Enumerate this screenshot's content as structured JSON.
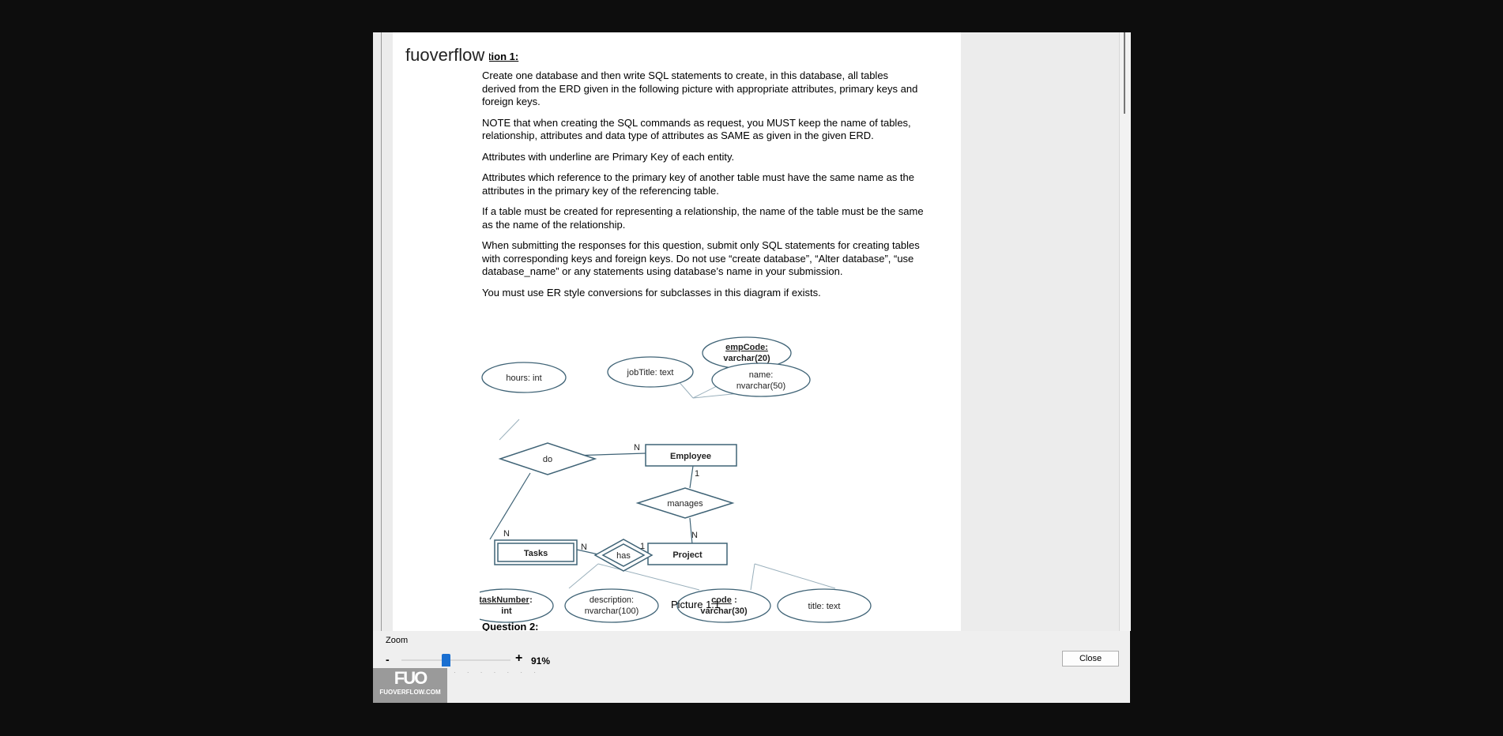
{
  "watermark": "fuoverflow",
  "question1_title": "stion 1:",
  "paragraphs": [
    "Create one database and then write SQL statements to create, in this database, all tables derived from the ERD given in the following picture with appropriate attributes, primary keys and foreign keys.",
    "NOTE that when creating the SQL commands as request, you MUST keep the name of tables, relationship, attributes and data type of attributes as SAME as given in the given ERD.",
    "Attributes with underline are Primary Key of each entity.",
    "Attributes which reference to the primary key of another table must have the same name as the attributes in the primary key of the referencing table.",
    "If a table must be created for representing a relationship, the name of the table must be the same as the name of the relationship.",
    "When submitting the responses for this question, submit only SQL statements for creating tables with corresponding keys and foreign keys. Do not use “create database”, “Alter database”, “use database_name” or any statements using database’s name in your submission.",
    "You must use ER style conversions for subclasses in this diagram if exists."
  ],
  "erd": {
    "emp_code_name": "empCode:",
    "emp_code_type": "varchar(20)",
    "job_title": "jobTitle: text",
    "name_attr": "name:",
    "name_type": "nvarchar(50)",
    "hours": "hours: int",
    "do": "do",
    "employee": "Employee",
    "manages": "manages",
    "tasks": "Tasks",
    "has": "has",
    "project": "Project",
    "task_number_name": "taskNumber",
    "task_number_colon": ":",
    "task_number_type": "int",
    "description": "description:",
    "description_type": "nvarchar(100)",
    "code_name": "code",
    "code_colon": ":",
    "code_type": "varchar(30)",
    "title": "title: text",
    "card_n_do_emp": "N",
    "card_1_emp": "1",
    "card_n_manages_proj": "N",
    "card_n_do_tasks": "N",
    "card_n_tasks_has": "N",
    "card_1_has_proj": "1"
  },
  "caption": "Picture 1.1",
  "question2": "Question 2:",
  "zoom": {
    "label": "Zoom",
    "minus": "-",
    "plus": "+",
    "percent_text": "91%",
    "value": 91
  },
  "close_button": "Close",
  "logo": {
    "big": "FUO",
    "small": "FUOVERFLOW.COM"
  }
}
